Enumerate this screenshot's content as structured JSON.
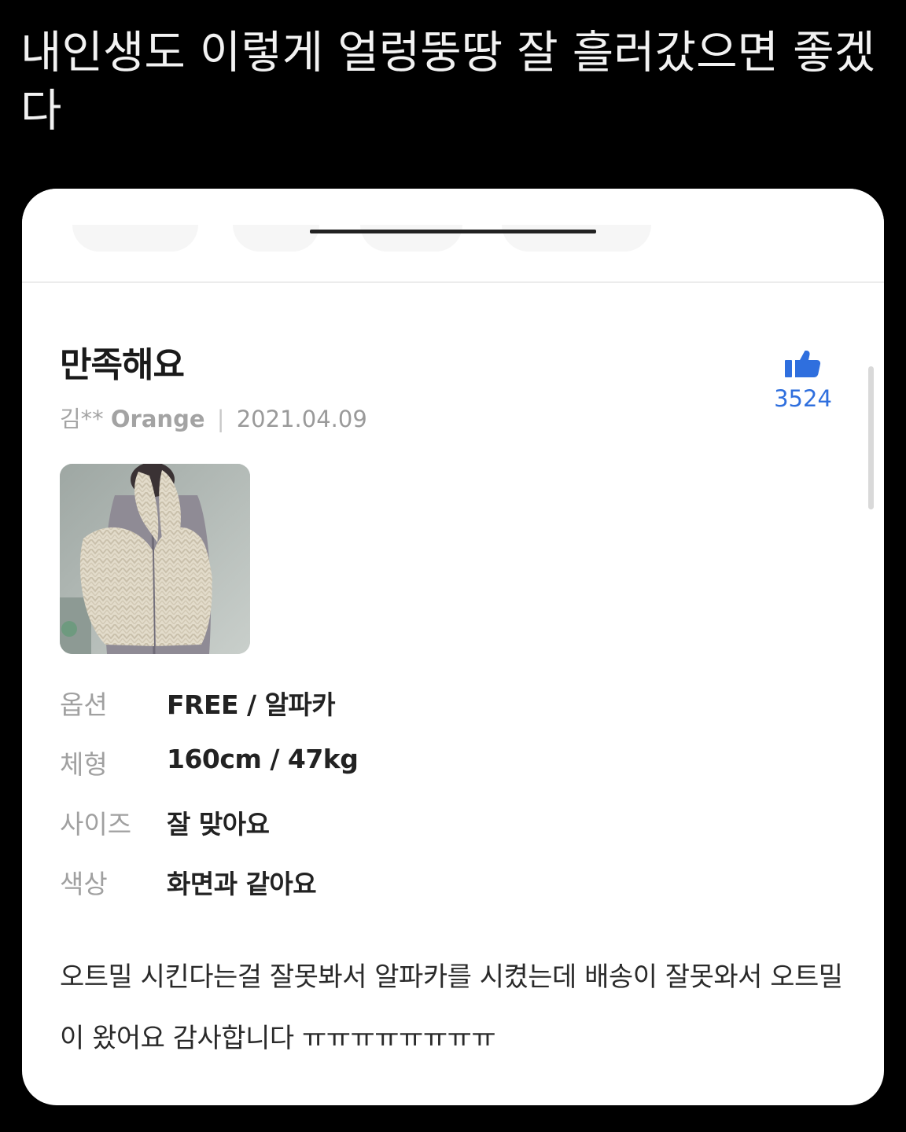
{
  "post": {
    "caption": "내인생도 이렇게 얼렁뚱땅 잘 흘러갔으면 좋겠다"
  },
  "review": {
    "title": "만족해요",
    "author": "김**",
    "option_color": "Orange",
    "separator": "|",
    "date": "2021.04.09",
    "likes": "3524",
    "photo_icon": "review-photo-cardigan",
    "specs": [
      {
        "label": "옵션",
        "value": "FREE / 알파카"
      },
      {
        "label": "체형",
        "value": "160cm / 47kg"
      },
      {
        "label": "사이즈",
        "value": "잘 맞아요"
      },
      {
        "label": "색상",
        "value": "화면과 같아요"
      }
    ],
    "body": "오트밀 시킨다는걸 잘못봐서 알파카를 시켰는데 배송이 잘못와서 오트밀이 왔어요 감사합니다 ㅠㅠㅠㅠㅠㅠㅠㅠ"
  },
  "colors": {
    "background": "#000000",
    "card": "#ffffff",
    "like_accent": "#2f6fde",
    "muted_text": "#a0a0a0"
  }
}
